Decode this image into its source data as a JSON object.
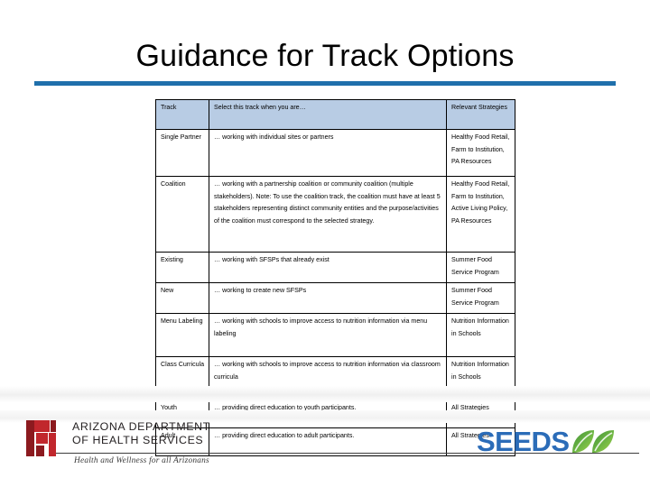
{
  "slide": {
    "title": "Guidance for Track Options",
    "accent_color": "#1f6fab",
    "header_fill": "#b8cce4"
  },
  "table": {
    "headers": {
      "track": "Track",
      "description": "Select this track when you are…",
      "strategies": "Relevant Strategies"
    },
    "rows": [
      {
        "track": "Single Partner",
        "description": "… working with individual sites or partners",
        "strategies": "Healthy Food Retail, Farm to Institution, PA Resources"
      },
      {
        "track": "Coalition",
        "description": "… working with a partnership coalition or community coalition (multiple stakeholders). Note: To use the coalition track, the coalition must have at least 5 stakeholders representing distinct community entities and the purpose/activities of the coalition must correspond to the selected strategy.",
        "strategies": "Healthy Food Retail, Farm to Institution, Active Living Policy, PA Resources"
      },
      {
        "track": "Existing",
        "description": "… working with SFSPs that already exist",
        "strategies": "Summer Food Service Program"
      },
      {
        "track": "New",
        "description": "… working to create new SFSPs",
        "strategies": "Summer Food Service Program"
      },
      {
        "track": "Menu Labeling",
        "description": "… working with schools to improve access to nutrition information via menu labeling",
        "strategies": "Nutrition Information in Schools"
      },
      {
        "track": "Class Curricula",
        "description": "… working with schools to improve access to nutrition information via classroom curricula",
        "strategies": "Nutrition Information in Schools"
      },
      {
        "track": "Youth",
        "description": "… providing direct education to youth participants.",
        "strategies": "All Strategies"
      },
      {
        "track": "Adult",
        "description": "… providing direct education to adult participants.",
        "strategies": "All Strategies"
      }
    ]
  },
  "footer": {
    "adhs": {
      "line1": "ARIZONA DEPARTMENT",
      "line2": "OF HEALTH SERVICES",
      "tagline": "Health and Wellness for all Arizonans",
      "mark_color": "#c1272d",
      "mark_dark_color": "#8c1a1f"
    },
    "seeds": {
      "word": "SEEDS",
      "word_color": "#2b6cb8",
      "leaf_color_dark": "#4a9c3f",
      "leaf_color_light": "#8dc63f"
    }
  }
}
